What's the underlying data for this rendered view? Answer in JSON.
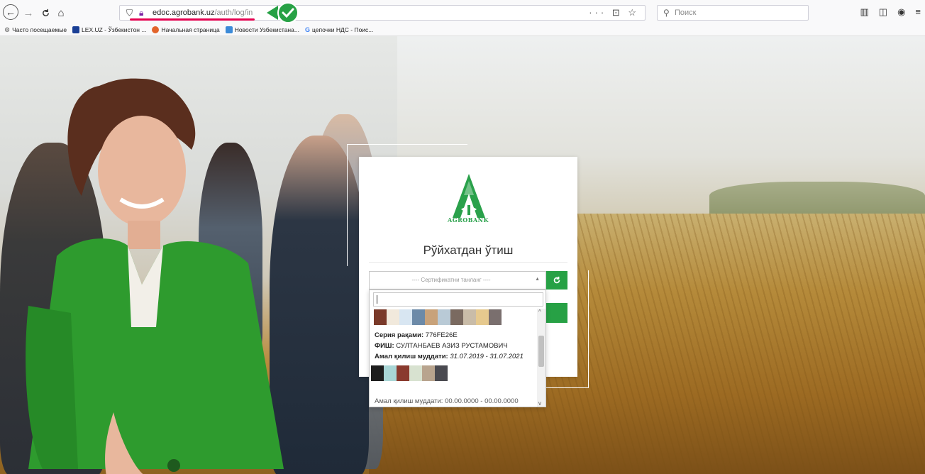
{
  "browser": {
    "url_domain": "edoc.agrobank.uz",
    "url_path": "/auth/log/in",
    "url_actions": "··· ⊡ ☆",
    "search_placeholder": "Поиск",
    "nav": {
      "back": "←",
      "forward": "→",
      "reload": "C",
      "home": "⌂"
    },
    "icons": [
      "shield-icon",
      "lock-icon",
      "check-badge-icon",
      "search-icon",
      "library-icon",
      "sidebar-icon",
      "account-icon",
      "menu-icon"
    ]
  },
  "bookmarks": [
    {
      "label": "Часто посещаемые",
      "icon": "gear-icon"
    },
    {
      "label": "LEX.UZ - Ўзбекистон ...",
      "icon": "lex-icon"
    },
    {
      "label": "Начальная страница",
      "icon": "firefox-icon"
    },
    {
      "label": "Новости Узбекистана...",
      "icon": "news-icon"
    },
    {
      "label": "цепочки НДС - Поис...",
      "icon": "google-icon"
    }
  ],
  "login": {
    "logo_text": "AGROBANK",
    "title": "Рўйхатдан ўтиш",
    "cert_placeholder": "---- Сертификатни танланг ----",
    "refresh_icon": "refresh-icon",
    "brand_color": "#27a145"
  },
  "dropdown": {
    "search_value": "",
    "selected_cert": {
      "serial_label": "Серия рақами:",
      "serial_value": "776FE26E",
      "name_label": "ФИШ:",
      "name_value": "СУЛТАНБАЕВ АЗИЗ РУСТАМОВИЧ",
      "validity_label": "Амал қилиш муддати:",
      "validity_value": "31.07.2019 - 31.07.2021"
    },
    "next_cert_partial": "Амал қилиш муддати: 00.00.0000 - 00.00.0000"
  }
}
